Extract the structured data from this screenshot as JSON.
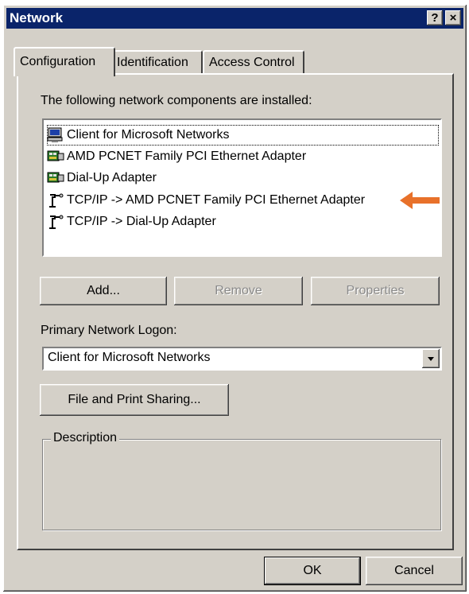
{
  "window": {
    "title": "Network",
    "help_button": "?",
    "close_button": "×"
  },
  "tabs": [
    {
      "label": "Configuration",
      "active": true
    },
    {
      "label": "Identification",
      "active": false
    },
    {
      "label": "Access Control",
      "active": false
    }
  ],
  "components": {
    "label": "The following network components are installed:",
    "items": [
      {
        "label": "Client for Microsoft Networks",
        "icon": "network-client-icon"
      },
      {
        "label": "AMD PCNET Family PCI Ethernet Adapter",
        "icon": "network-adapter-icon"
      },
      {
        "label": "Dial-Up Adapter",
        "icon": "network-adapter-icon"
      },
      {
        "label": "TCP/IP -> AMD PCNET Family PCI Ethernet Adapter",
        "icon": "protocol-icon",
        "highlighted": true
      },
      {
        "label": "TCP/IP -> Dial-Up Adapter",
        "icon": "protocol-icon"
      }
    ],
    "annotation_arrow_color": "#e8712a"
  },
  "buttons": {
    "add": "Add...",
    "remove": "Remove",
    "properties": "Properties",
    "file_print": "File and Print Sharing...",
    "ok": "OK",
    "cancel": "Cancel"
  },
  "logon": {
    "label": "Primary Network Logon:",
    "value": "Client for Microsoft Networks"
  },
  "description": {
    "legend": "Description"
  },
  "colors": {
    "title_bar": "#0a246a",
    "face": "#d4d0c8"
  }
}
